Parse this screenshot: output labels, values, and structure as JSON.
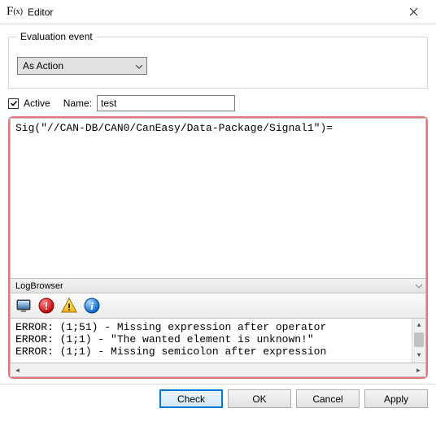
{
  "window": {
    "title": "Editor"
  },
  "eval_group": {
    "legend": "Evaluation event",
    "dropdown_value": "As Action"
  },
  "active": {
    "label": "Active",
    "checked": true
  },
  "name": {
    "label": "Name:",
    "value": "test"
  },
  "code": "Sig(\"//CAN-DB/CAN0/CanEasy/Data-Package/Signal1\")=",
  "log": {
    "header": "LogBrowser",
    "lines": [
      "ERROR: (1;51) - Missing expression after operator",
      "ERROR: (1;1) - \"The wanted element is unknown!\"",
      "ERROR: (1;1) - Missing semicolon after expression"
    ]
  },
  "buttons": {
    "check": "Check",
    "ok": "OK",
    "cancel": "Cancel",
    "apply": "Apply"
  }
}
